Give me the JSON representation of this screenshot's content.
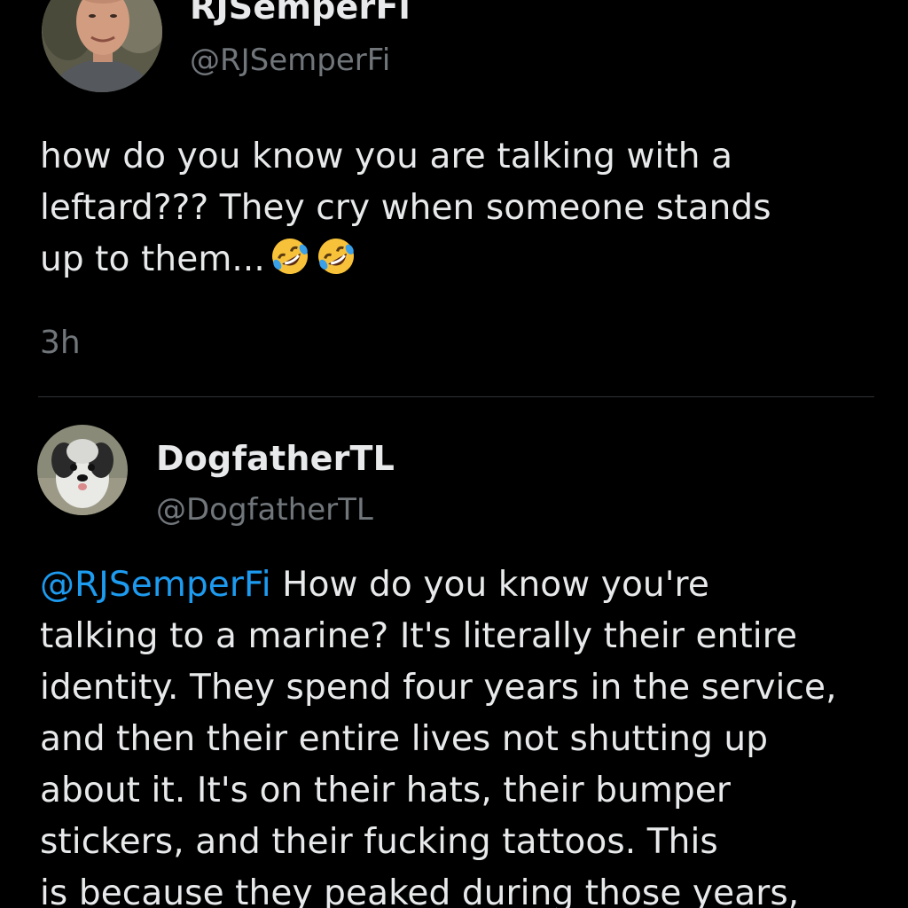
{
  "tweet1": {
    "display_name": "RJSemperFi",
    "handle": "@RJSemperFi",
    "avatar_icon": "profile-photo-man",
    "lines": [
      "how do you know you are talking with a",
      "leftard??? They cry when someone stands",
      "up to them..."
    ],
    "emoji_icon": "rolling-on-floor-laughing-emoji",
    "emoji_count": 2,
    "timestamp": "3h"
  },
  "tweet2": {
    "display_name": "DogfatherTL",
    "handle": "@DogfatherTL",
    "avatar_icon": "profile-photo-dog",
    "mention": "@RJSemperFi",
    "first_line_rest": " How do you know you're",
    "lines": [
      "talking to a marine? It's literally their entire",
      "identity. They spend four years in the service,",
      "and then their entire lives not shutting up",
      "about it. It's on their hats, their bumper",
      "stickers, and their fucking tattoos. This",
      "is because they peaked during those years,"
    ]
  },
  "colors": {
    "background": "#000000",
    "text": "#e7e9ea",
    "secondary": "#71767b",
    "mention": "#1d9bf0",
    "divider": "#2f3336"
  }
}
